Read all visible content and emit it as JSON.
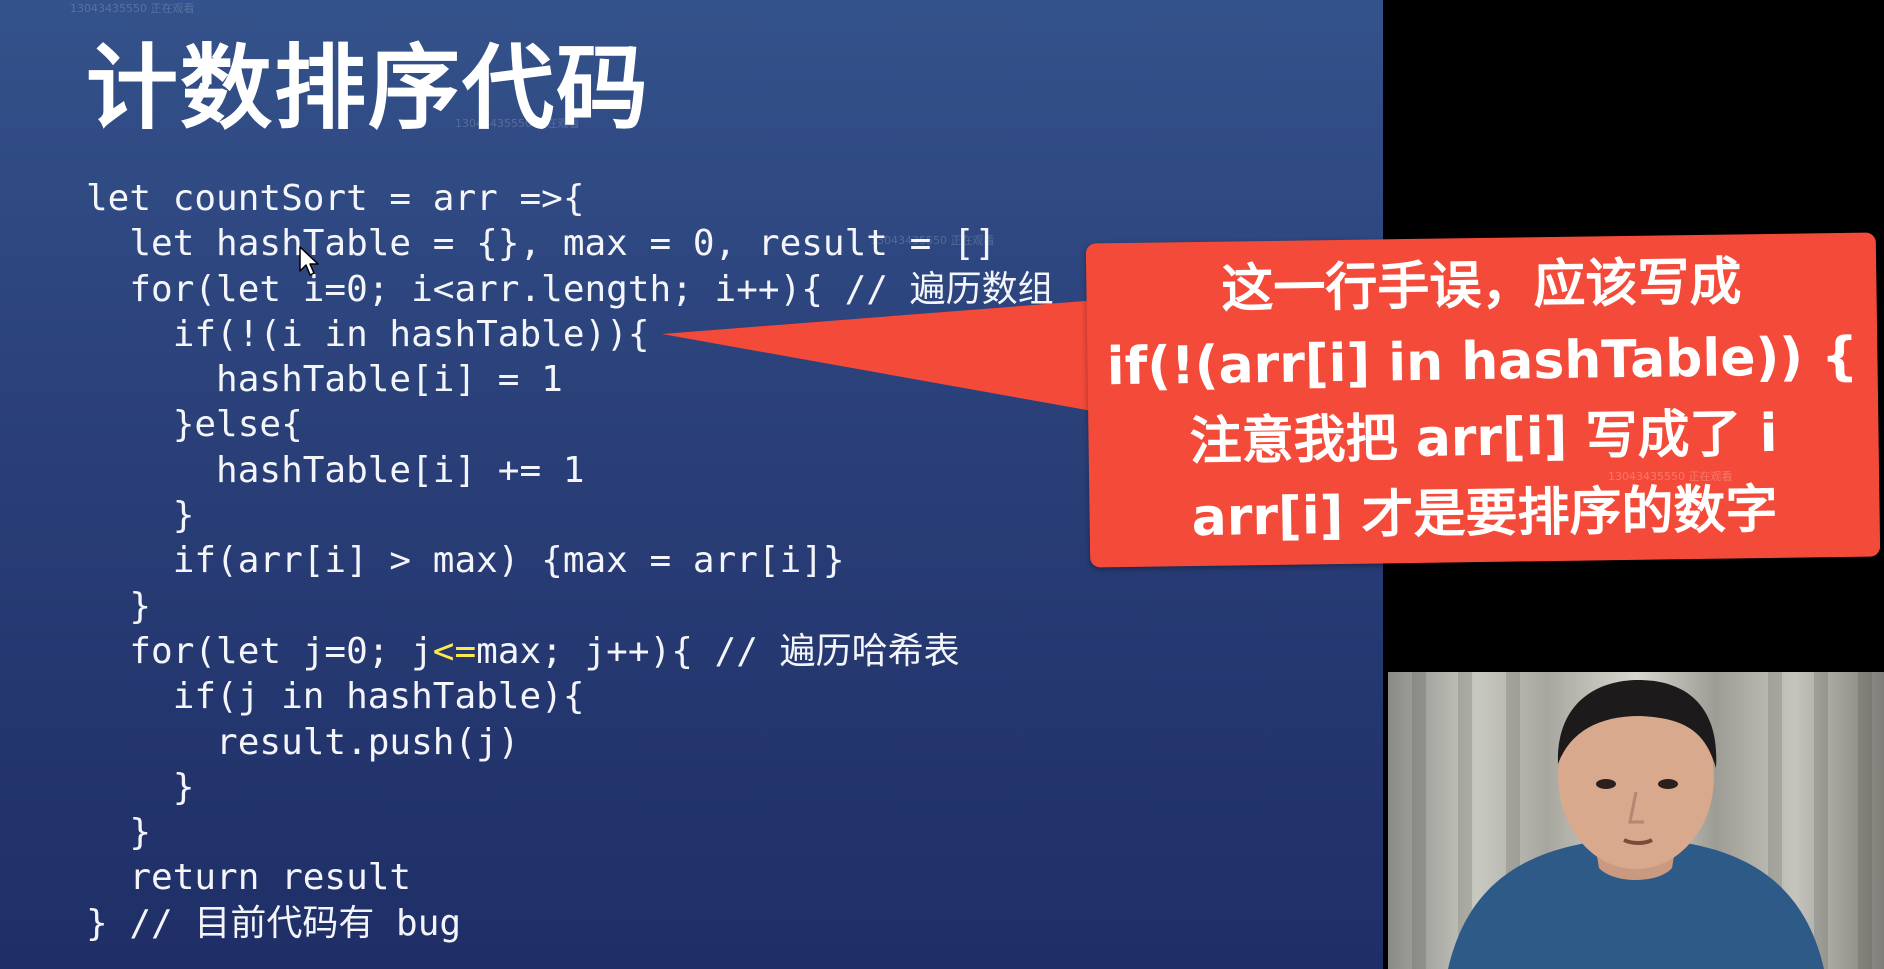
{
  "watermark": "13043435550 正在观看",
  "slide": {
    "title": "计数排序代码",
    "code_lines": [
      {
        "text": "let countSort = arr =>{"
      },
      {
        "text": "  let hashTable = {}, max = 0, result = []"
      },
      {
        "text": "  for(let i=0; i<arr.length; i++){ // 遍历数组"
      },
      {
        "text": "    if(!(i in hashTable)){"
      },
      {
        "text": "      hashTable[i] = 1"
      },
      {
        "text": "    }else{"
      },
      {
        "text": "      hashTable[i] += 1"
      },
      {
        "text": "    }"
      },
      {
        "text": "    if(arr[i] > max) {max = arr[i]}"
      },
      {
        "text": "  }"
      },
      {
        "text": "  for(let j=0; j",
        "highlight": "<=",
        "after": "max; j++){ // 遍历哈希表"
      },
      {
        "text": "    if(j in hashTable){"
      },
      {
        "text": "      result.push(j)"
      },
      {
        "text": "    }"
      },
      {
        "text": "  }"
      },
      {
        "text": "  return result"
      },
      {
        "text": "} // 目前代码有 bug"
      }
    ]
  },
  "callout": {
    "lines": [
      "这一行手误，应该写成",
      "if(!(arr[i] in hashTable)) {",
      "注意我把 arr[i] 写成了 i",
      "arr[i] 才是要排序的数字"
    ],
    "color": "#f44a39"
  },
  "colors": {
    "slide_bg": "#2a3f78",
    "code_text": "#f3f5fa",
    "code_highlight": "#ffe84a"
  }
}
